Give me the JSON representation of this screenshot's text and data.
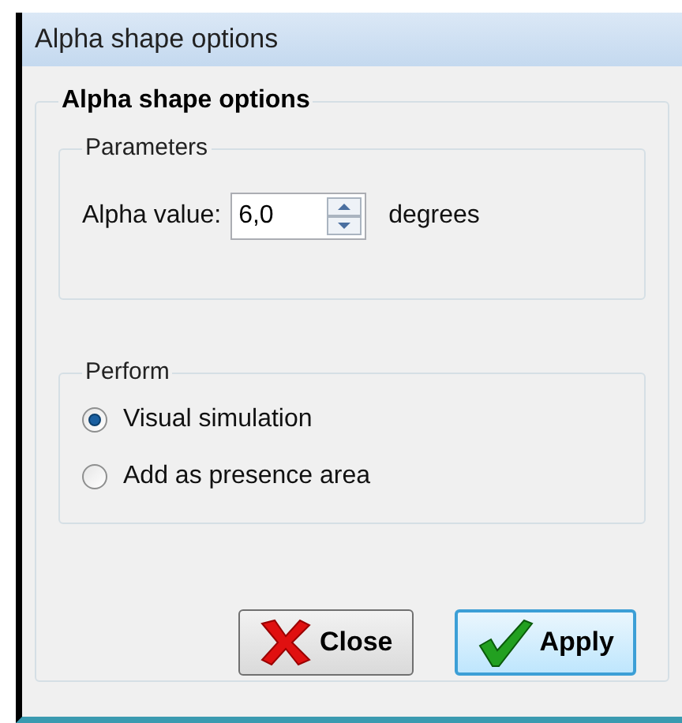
{
  "window": {
    "title": "Alpha shape options"
  },
  "group": {
    "title": "Alpha shape options"
  },
  "parameters": {
    "title": "Parameters",
    "label": "Alpha value:",
    "value": "6,0",
    "unit": "degrees"
  },
  "perform": {
    "title": "Perform",
    "options": [
      {
        "label": "Visual simulation",
        "selected": true
      },
      {
        "label": "Add as presence area",
        "selected": false
      }
    ]
  },
  "buttons": [
    {
      "kind": "close",
      "label": "Close",
      "focused": false
    },
    {
      "kind": "apply",
      "label": "Apply",
      "focused": true
    }
  ]
}
